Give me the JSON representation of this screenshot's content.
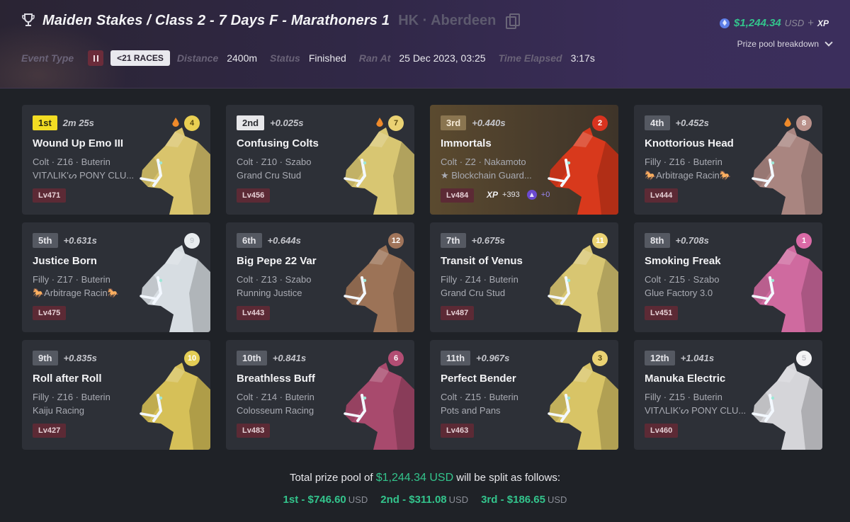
{
  "header": {
    "title": "Maiden Stakes / Class 2 - 7 Days F - Marathoners 1",
    "location": "HK · Aberdeen",
    "event_type_label": "Event Type",
    "races_badge": "<21 RACES",
    "distance_label": "Distance",
    "distance": "2400m",
    "status_label": "Status",
    "status": "Finished",
    "ran_at_label": "Ran At",
    "ran_at": "25 Dec 2023, 03:25",
    "elapsed_label": "Time Elapsed",
    "elapsed": "3:17s",
    "prize_amount": "$1,244.34",
    "prize_currency": "USD",
    "prize_plus": "+",
    "prize_xp": "XP",
    "breakdown_label": "Prize pool breakdown"
  },
  "colors": {
    "accent_green": "#33c48c",
    "first_badge": "#f2dc23",
    "level_badge": "#5c2a35"
  },
  "cards": [
    {
      "pos": "1st",
      "gap": "2m 25s",
      "name": "Wound Up Emo III",
      "info": "Colt · Z16 · Buterin",
      "stable": "VITΛLIK'ᔕ PONY CLU...",
      "lv": "Lv471",
      "gate": "4",
      "gate_color": "#e9cf52",
      "gate_text": "#5a4a10",
      "flame": true,
      "horse_color": "#d9c46c"
    },
    {
      "pos": "2nd",
      "gap": "+0.025s",
      "name": "Confusing Colts",
      "info": "Colt · Z10 · Szabo",
      "stable": "Grand Cru Stud",
      "lv": "Lv456",
      "gate": "7",
      "gate_color": "#ead273",
      "gate_text": "#5a4a10",
      "flame": true,
      "horse_color": "#d8c672"
    },
    {
      "pos": "3rd",
      "gap": "+0.440s",
      "name": "Immortals",
      "info": "Colt · Z2 · Nakamoto",
      "stable": "★ Blockchain Guard...",
      "lv": "Lv484",
      "gate": "2",
      "gate_color": "#d9331f",
      "gate_text": "#ffffff",
      "flame": false,
      "horse_color": "#d8391c",
      "xp_label": "XP",
      "xp_value": "+393",
      "xp_gem": "+0"
    },
    {
      "pos": "4th",
      "gap": "+0.452s",
      "name": "Knottorious Head",
      "info": "Filly · Z16 · Buterin",
      "stable": "🐎Arbitrage Racin🐎",
      "lv": "Lv444",
      "gate": "8",
      "gate_color": "#b9908a",
      "gate_text": "#ffffff",
      "flame": true,
      "horse_color": "#a98580"
    },
    {
      "pos": "5th",
      "gap": "+0.631s",
      "name": "Justice Born",
      "info": "Filly · Z17 · Buterin",
      "stable": "🐎Arbitrage Racin🐎",
      "lv": "Lv475",
      "gate": "9",
      "gate_color": "#e8ecef",
      "gate_text": "#c7cdd2",
      "flame": false,
      "horse_color": "#d7dde2"
    },
    {
      "pos": "6th",
      "gap": "+0.644s",
      "name": "Big Pepe 22 Var",
      "info": "Colt · Z13 · Szabo",
      "stable": "Running Justice",
      "lv": "Lv443",
      "gate": "12",
      "gate_color": "#a0745a",
      "gate_text": "#ffffff",
      "flame": false,
      "horse_color": "#9c7357"
    },
    {
      "pos": "7th",
      "gap": "+0.675s",
      "name": "Transit of Venus",
      "info": "Filly · Z14 · Buterin",
      "stable": "Grand Cru Stud",
      "lv": "Lv487",
      "gate": "11",
      "gate_color": "#ead273",
      "gate_text": "#ffffff",
      "flame": false,
      "horse_color": "#d8c672"
    },
    {
      "pos": "8th",
      "gap": "+0.708s",
      "name": "Smoking Freak",
      "info": "Colt · Z15 · Szabo",
      "stable": "Glue Factory 3.0",
      "lv": "Lv451",
      "gate": "1",
      "gate_color": "#d96aa6",
      "gate_text": "#ffffff",
      "flame": false,
      "horse_color": "#cf6a9f"
    },
    {
      "pos": "9th",
      "gap": "+0.835s",
      "name": "Roll after Roll",
      "info": "Filly · Z16 · Buterin",
      "stable": "Kaiju Racing",
      "lv": "Lv427",
      "gate": "10",
      "gate_color": "#e3cd55",
      "gate_text": "#ffffff",
      "flame": false,
      "horse_color": "#d6c058"
    },
    {
      "pos": "10th",
      "gap": "+0.841s",
      "name": "Breathless Buff",
      "info": "Colt · Z14 · Buterin",
      "stable": "Colosseum Racing",
      "lv": "Lv483",
      "gate": "6",
      "gate_color": "#b24d73",
      "gate_text": "#ffffff",
      "flame": false,
      "horse_color": "#a84a6d"
    },
    {
      "pos": "11th",
      "gap": "+0.967s",
      "name": "Perfect Bender",
      "info": "Colt · Z15 · Buterin",
      "stable": "Pots and Pans",
      "lv": "Lv463",
      "gate": "3",
      "gate_color": "#ead273",
      "gate_text": "#5a4a10",
      "flame": false,
      "horse_color": "#d8c466"
    },
    {
      "pos": "12th",
      "gap": "+1.041s",
      "name": "Manuka Electric",
      "info": "Filly · Z15 · Buterin",
      "stable": "VITΛLIK'ᔕ PONY CLU...",
      "lv": "Lv460",
      "gate": "5",
      "gate_color": "#f3f3f5",
      "gate_text": "#c5c5cb",
      "flame": false,
      "horse_color": "#d5d5d9"
    }
  ],
  "footer": {
    "pre": "Total prize pool of",
    "amount": "$1,244.34 USD",
    "post": "will be split as follows:",
    "splits": [
      {
        "label": "1st - $746.60",
        "unit": "USD"
      },
      {
        "label": "2nd - $311.08",
        "unit": "USD"
      },
      {
        "label": "3rd - $186.65",
        "unit": "USD"
      }
    ]
  }
}
